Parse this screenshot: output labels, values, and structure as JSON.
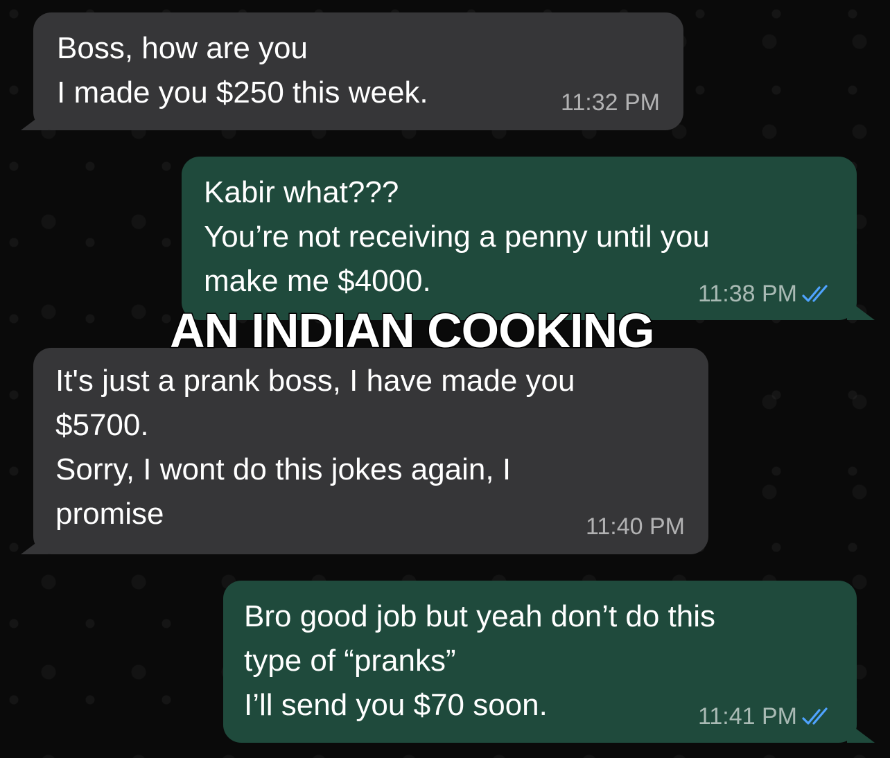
{
  "overlay_caption": "AN INDIAN COOKING",
  "colors": {
    "incoming_bubble": "#363638",
    "outgoing_bubble": "#1f4a3c",
    "read_ticks": "#4fa3ff",
    "background": "#0a0a0a"
  },
  "messages": [
    {
      "direction": "incoming",
      "text": "Boss, how are you\nI made you $250 this week.",
      "time": "11:32 PM",
      "read_receipt": false
    },
    {
      "direction": "outgoing",
      "text": "Kabir what???\nYou’re not receiving a penny until you\nmake me $4000.",
      "time": "11:38 PM",
      "read_receipt": true,
      "receipt_icon": "double-check-icon"
    },
    {
      "direction": "incoming",
      "text": "It's just a prank boss, I have made you\n$5700.\nSorry, I wont do this jokes again, I\npromise",
      "time": "11:40 PM",
      "read_receipt": false
    },
    {
      "direction": "outgoing",
      "text": "Bro good job but yeah don’t do this\ntype of “pranks”\nI’ll send you $70 soon.",
      "time": "11:41 PM",
      "read_receipt": true,
      "receipt_icon": "double-check-icon"
    }
  ]
}
